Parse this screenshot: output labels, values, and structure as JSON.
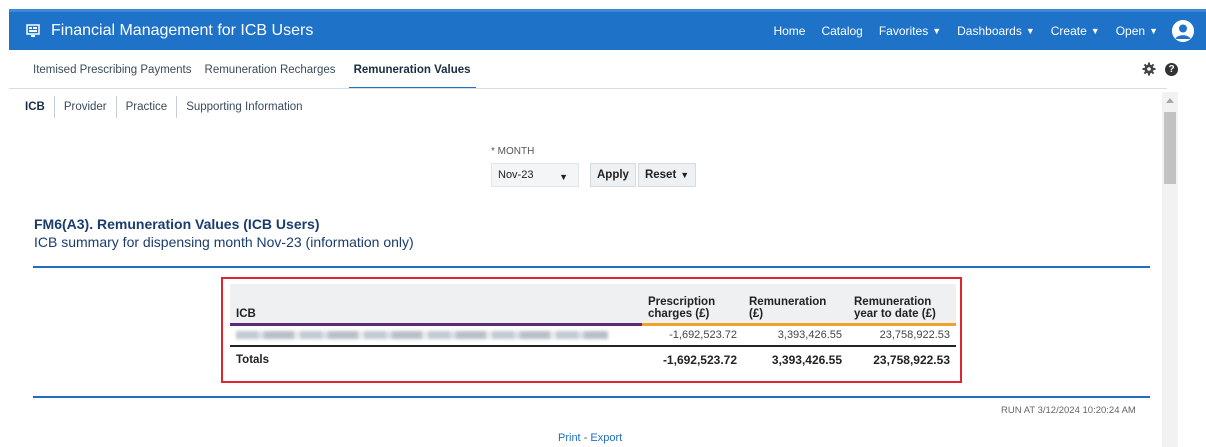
{
  "header": {
    "app_title": "Financial Management for ICB Users",
    "nav": [
      {
        "label": "Home",
        "has_caret": false
      },
      {
        "label": "Catalog",
        "has_caret": false
      },
      {
        "label": "Favorites",
        "has_caret": true
      },
      {
        "label": "Dashboards",
        "has_caret": true
      },
      {
        "label": "Create",
        "has_caret": true
      },
      {
        "label": "Open",
        "has_caret": true
      }
    ],
    "color": "#1e73c9"
  },
  "tabs": {
    "items": [
      "Itemised Prescribing Payments",
      "Remuneration Recharges",
      "Remuneration Values"
    ],
    "active": "Remuneration Values"
  },
  "subtabs": {
    "items": [
      "ICB",
      "Provider",
      "Practice",
      "Supporting Information"
    ],
    "active": "ICB"
  },
  "prompt": {
    "label": "* MONTH",
    "selected": "Nov-23",
    "apply_label": "Apply",
    "reset_label": "Reset"
  },
  "report": {
    "title": "FM6(A3). Remuneration Values (ICB Users)",
    "subtitle": "ICB summary for dispensing month Nov-23 (information only)",
    "table": {
      "headers": [
        "ICB",
        "Prescription charges (£)",
        "Remuneration (£)",
        "Remuneration year to date (£)"
      ],
      "rows": [
        {
          "icb": "",
          "prescription_charges": "-1,692,523.72",
          "remuneration": "3,393,426.55",
          "remuneration_ytd": "23,758,922.53"
        }
      ],
      "totals": {
        "label": "Totals",
        "prescription_charges": "-1,692,523.72",
        "remuneration": "3,393,426.55",
        "remuneration_ytd": "23,758,922.53"
      }
    },
    "run_at": "RUN AT 3/12/2024 10:20:24 AM"
  },
  "footer": {
    "print_label": "Print",
    "separator": "-",
    "export_label": "Export"
  },
  "icons": [
    "app-icon",
    "caret-down-icon",
    "user-avatar-icon",
    "gear-icon",
    "help-icon",
    "scroll-up-icon"
  ]
}
